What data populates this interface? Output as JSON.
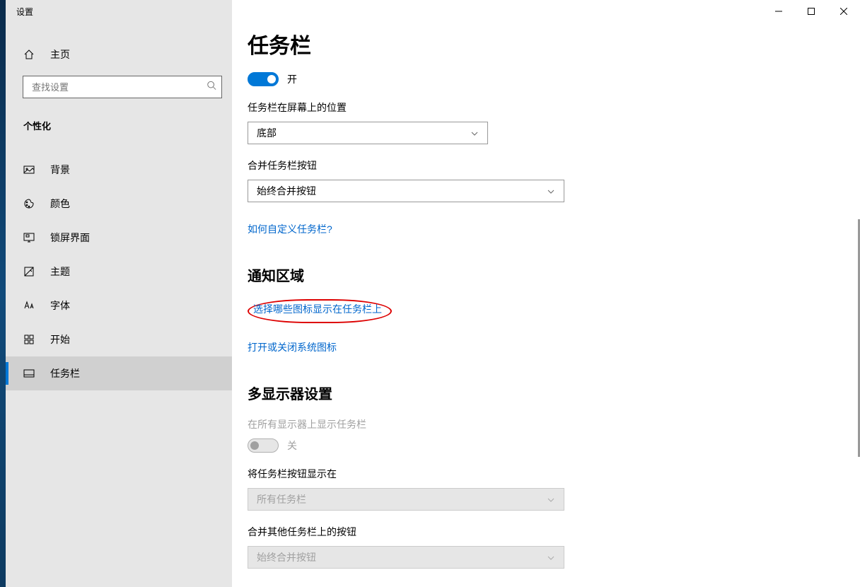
{
  "window": {
    "title": "设置"
  },
  "sidebar": {
    "home": "主页",
    "search_placeholder": "查找设置",
    "category": "个性化",
    "items": [
      {
        "label": "背景"
      },
      {
        "label": "颜色"
      },
      {
        "label": "锁屏界面"
      },
      {
        "label": "主题"
      },
      {
        "label": "字体"
      },
      {
        "label": "开始"
      },
      {
        "label": "任务栏"
      }
    ]
  },
  "main": {
    "title": "任务栏",
    "toggle1_state": "开",
    "position_label": "任务栏在屏幕上的位置",
    "position_value": "底部",
    "combine_label": "合并任务栏按钮",
    "combine_value": "始终合并按钮",
    "help_link": "如何自定义任务栏?",
    "notify_section": "通知区域",
    "notify_link1": "选择哪些图标显示在任务栏上",
    "notify_link2": "打开或关闭系统图标",
    "multi_section": "多显示器设置",
    "multi_toggle_label": "在所有显示器上显示任务栏",
    "multi_toggle_state": "关",
    "multi_show_label": "将任务栏按钮显示在",
    "multi_show_value": "所有任务栏",
    "multi_combine_label": "合并其他任务栏上的按钮",
    "multi_combine_value": "始终合并按钮"
  }
}
